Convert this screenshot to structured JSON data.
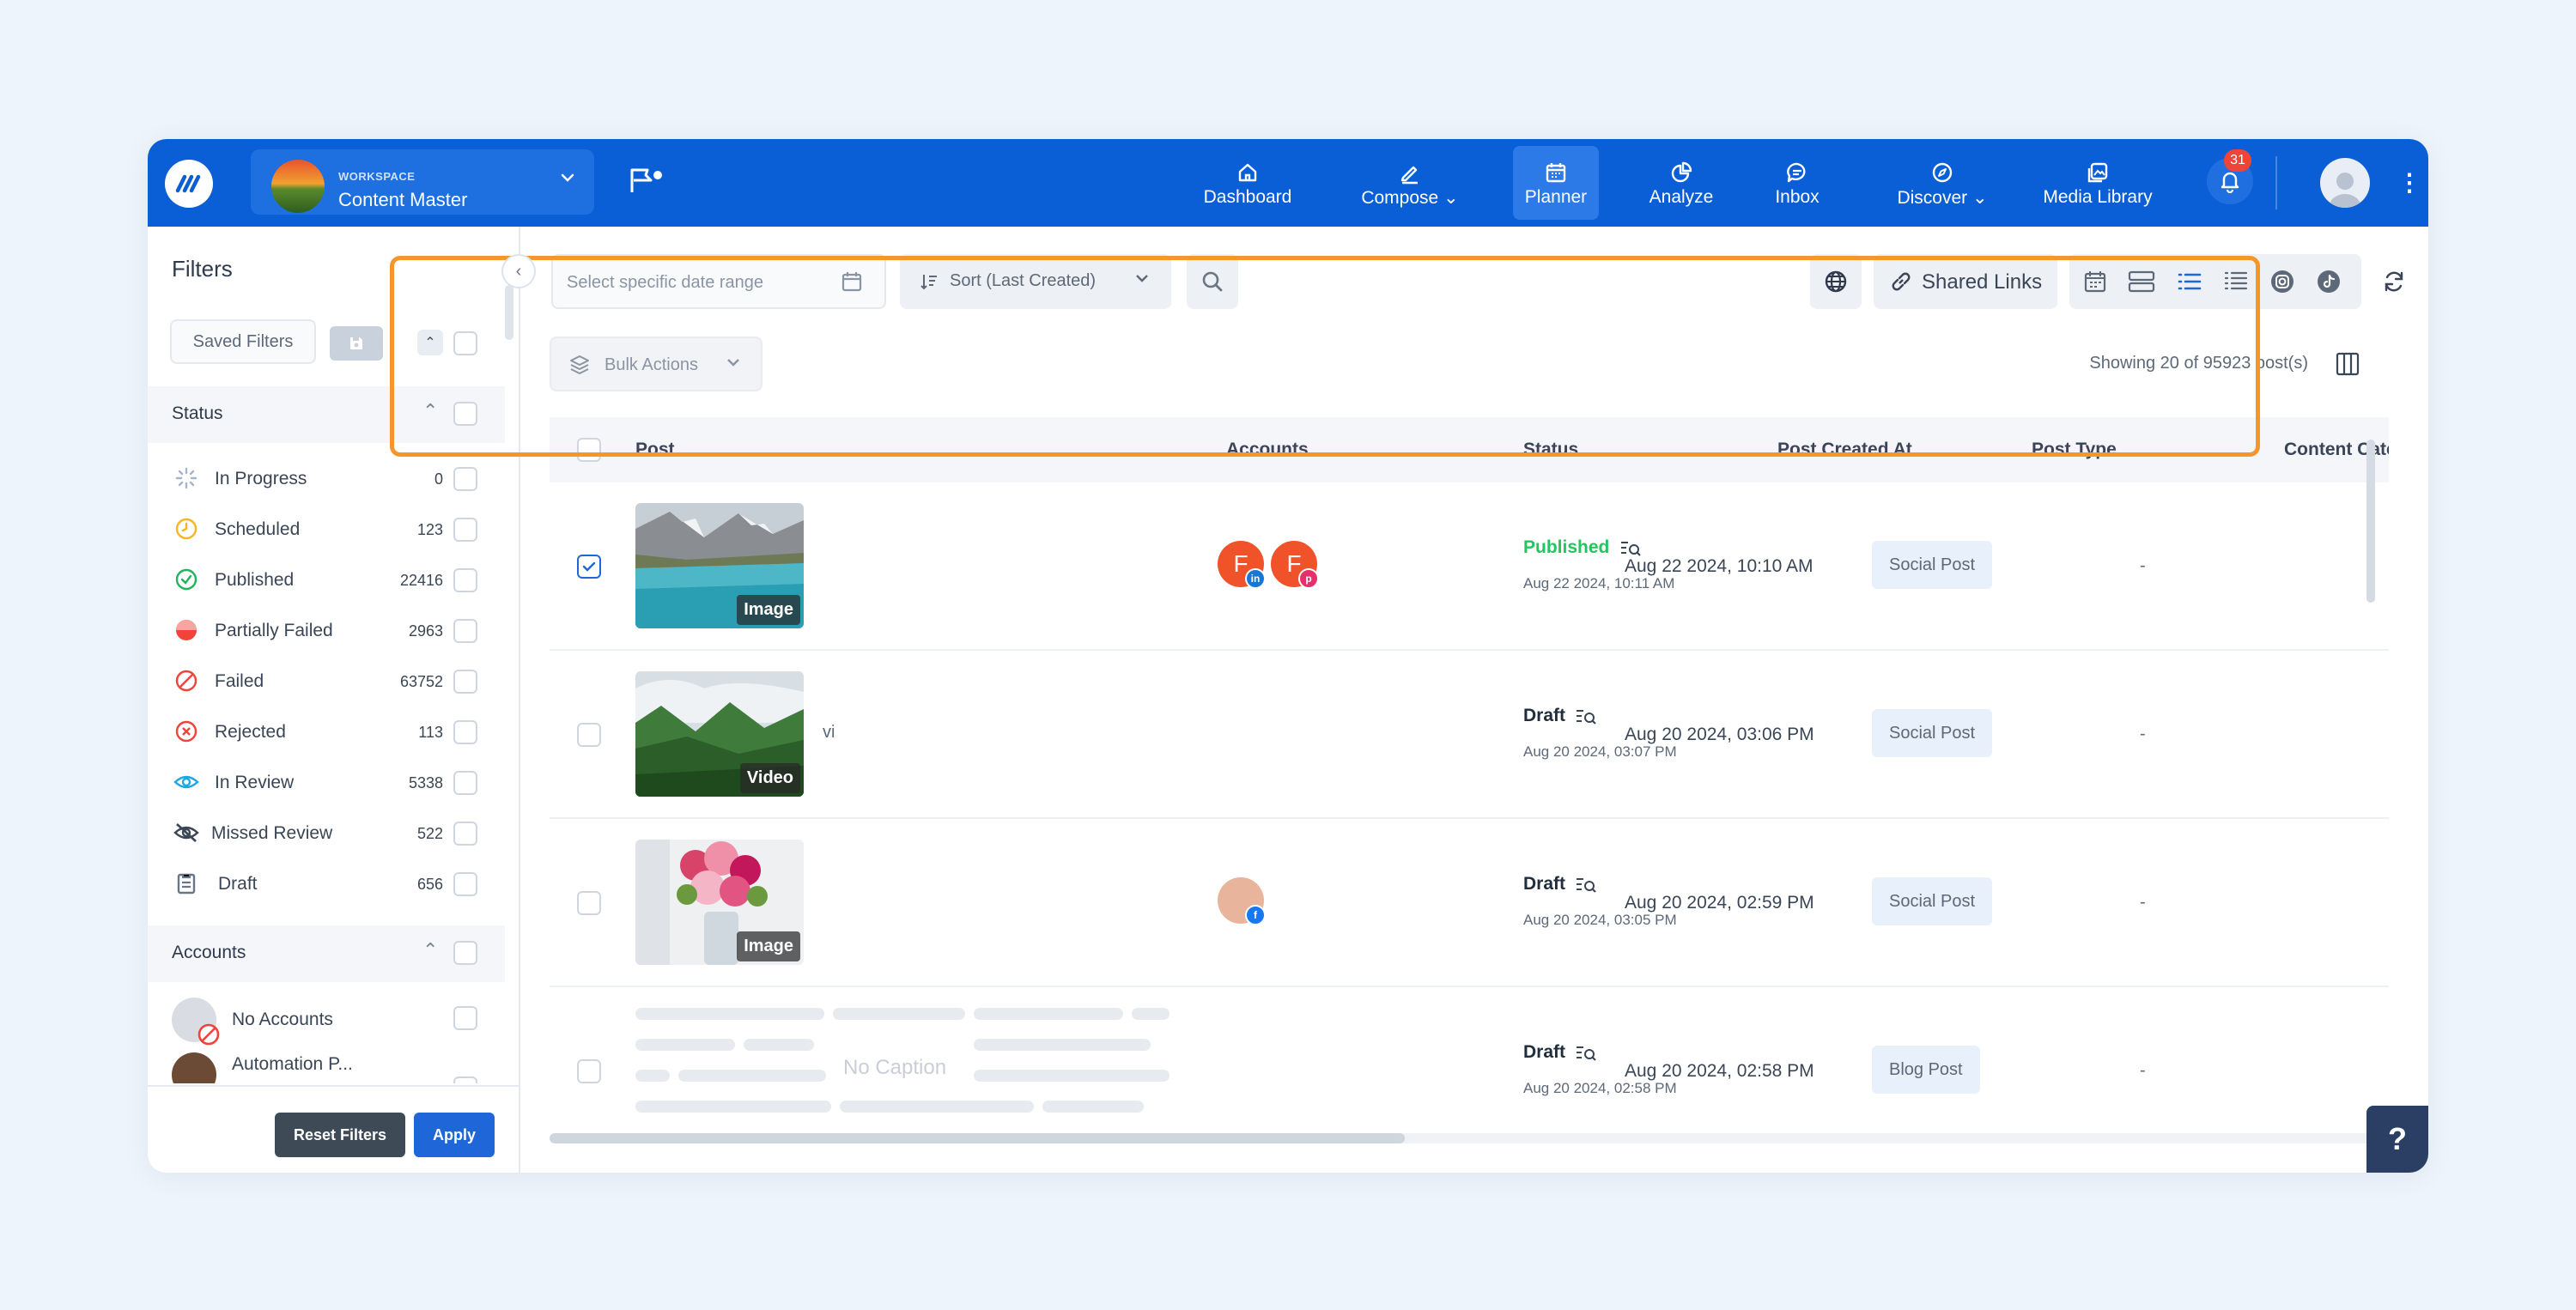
{
  "topbar": {
    "workspace_label": "WORKSPACE",
    "workspace_name": "Content Master",
    "nav": [
      {
        "label": "Dashboard",
        "icon": "home-icon"
      },
      {
        "label": "Compose",
        "icon": "pencil-icon"
      },
      {
        "label": "Planner",
        "icon": "calendar-icon",
        "active": true
      },
      {
        "label": "Analyze",
        "icon": "pie-chart-icon"
      },
      {
        "label": "Inbox",
        "icon": "chat-icon"
      },
      {
        "label": "Discover",
        "icon": "compass-icon"
      },
      {
        "label": "Media Library",
        "icon": "image-icon"
      }
    ],
    "notification_count": "31"
  },
  "sidebar": {
    "title": "Filters",
    "saved_filters": "Saved Filters",
    "status_header": "Status",
    "statuses": [
      {
        "label": "In Progress",
        "count": "0",
        "color": "#a7b3c8"
      },
      {
        "label": "Scheduled",
        "count": "123",
        "color": "#f5b623"
      },
      {
        "label": "Published",
        "count": "22416",
        "color": "#22b35e"
      },
      {
        "label": "Partially Failed",
        "count": "2963",
        "color": "#f0443a"
      },
      {
        "label": "Failed",
        "count": "63752",
        "color": "#f0443a"
      },
      {
        "label": "Rejected",
        "count": "113",
        "color": "#f0443a"
      },
      {
        "label": "In Review",
        "count": "5338",
        "color": "#1ea7e0"
      },
      {
        "label": "Missed Review",
        "count": "522",
        "color": "#3a4556"
      },
      {
        "label": "Draft",
        "count": "656",
        "color": "#6b7685"
      }
    ],
    "accounts_header": "Accounts",
    "accounts": [
      {
        "label": "No Accounts"
      },
      {
        "label": "Automation P..."
      }
    ],
    "reset_label": "Reset Filters",
    "apply_label": "Apply"
  },
  "toolbar": {
    "date_placeholder": "Select specific date range",
    "sort_label": "Sort (Last Created)",
    "shared_links": "Shared Links",
    "bulk_actions": "Bulk Actions",
    "showing": "Showing 20 of 95923 post(s)"
  },
  "table": {
    "headers": [
      "Post",
      "Accounts",
      "Status",
      "Post Created At",
      "Post Type",
      "Content Cate"
    ],
    "rows": [
      {
        "media_tag": "Image",
        "caption": "",
        "status": "Published",
        "status_color": "#22c55e",
        "status_date": "Aug 22 2024, 10:11 AM",
        "created": "Aug 22 2024, 10:10 AM",
        "type": "Social Post",
        "category": "-",
        "checked": true
      },
      {
        "media_tag": "Video",
        "caption": "vi",
        "status": "Draft",
        "status_color": "#1f2d3d",
        "status_date": "Aug 20 2024, 03:07 PM",
        "created": "Aug 20 2024, 03:06 PM",
        "type": "Social Post",
        "category": "-",
        "checked": false
      },
      {
        "media_tag": "Image",
        "caption": "",
        "status": "Draft",
        "status_color": "#1f2d3d",
        "status_date": "Aug 20 2024, 03:05 PM",
        "created": "Aug 20 2024, 02:59 PM",
        "type": "Social Post",
        "category": "-",
        "checked": false
      },
      {
        "media_tag": "",
        "caption": "No Caption",
        "status": "Draft",
        "status_color": "#1f2d3d",
        "status_date": "Aug 20 2024, 02:58 PM",
        "created": "Aug 20 2024, 02:58 PM",
        "type": "Blog Post",
        "category": "-",
        "checked": false
      }
    ],
    "row1_accounts": [
      "F",
      "F"
    ]
  },
  "help_label": "?",
  "colors": {
    "brand": "#0b5fd6",
    "highlight": "#f5962a"
  }
}
